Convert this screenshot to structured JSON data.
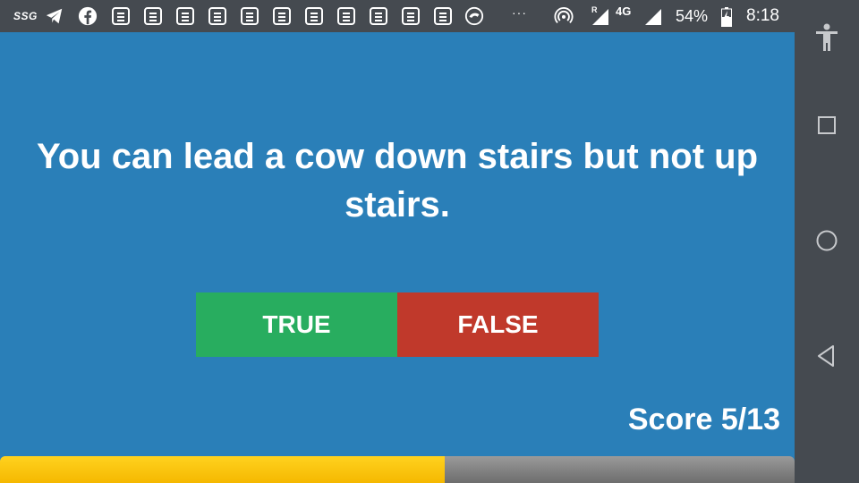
{
  "status_bar": {
    "carrier_label": "SSG",
    "notification_icons": [
      "telegram-icon",
      "facebook-icon",
      "notification-icon",
      "notification-icon",
      "notification-icon",
      "notification-icon",
      "notification-icon",
      "notification-icon",
      "notification-icon",
      "notification-icon",
      "notification-icon",
      "notification-icon",
      "sync-icon"
    ],
    "overflow_dots": "···",
    "roaming_label": "R",
    "network_type": "4G",
    "battery_percent": "54%",
    "time": "8:18"
  },
  "quiz": {
    "question": "You can lead a cow down stairs but not up stairs.",
    "true_label": "TRUE",
    "false_label": "FALSE",
    "score_text": "Score 5/13",
    "progress_fraction": 0.56
  },
  "colors": {
    "background": "#2a7fb8",
    "true_button": "#28ad5f",
    "false_button": "#c0392b",
    "progress_fill": "#ffc107",
    "system_bars": "#454a50"
  },
  "navigation_bar": {
    "buttons": [
      "accessibility-icon",
      "recents-icon",
      "home-icon",
      "back-icon"
    ]
  }
}
